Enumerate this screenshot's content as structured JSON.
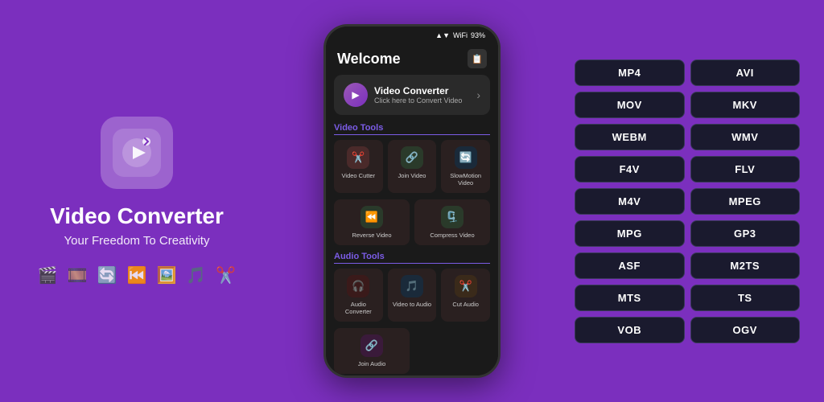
{
  "app": {
    "title": "Video Converter",
    "subtitle": "Your Freedom To Creativity",
    "icon_label": "app-icon"
  },
  "phone": {
    "status_bar": {
      "time": "",
      "signal": "▲▼",
      "wifi": "WiFi",
      "battery": "93%"
    },
    "header": {
      "title": "Welcome",
      "icon": "📋"
    },
    "banner": {
      "title": "Video Converter",
      "subtitle": "Click here to Convert Video"
    },
    "video_tools_label": "Video Tools",
    "video_tools": [
      {
        "name": "Video Cutter",
        "icon": "✂️",
        "color": "#4a2020"
      },
      {
        "name": "Join Video",
        "icon": "🔗",
        "color": "#2a3a20"
      },
      {
        "name": "SlowMotion Video",
        "icon": "🔄",
        "color": "#1a2a3a"
      },
      {
        "name": "Reverse Video",
        "icon": "⏪",
        "color": "#2a3a20"
      },
      {
        "name": "Compress Video",
        "icon": "🗜️",
        "color": "#2a3a20"
      }
    ],
    "audio_tools_label": "Audio Tools",
    "audio_tools": [
      {
        "name": "Audio Converter",
        "icon": "🎧",
        "color": "#3a1a1a"
      },
      {
        "name": "Video to Audio",
        "icon": "🎵",
        "color": "#1a2a3a"
      },
      {
        "name": "Cut Audio",
        "icon": "✂️",
        "color": "#3a2a1a"
      },
      {
        "name": "Join Audio",
        "icon": "🔗",
        "color": "#3a1a3a"
      }
    ]
  },
  "formats": [
    "MP4",
    "AVI",
    "MOV",
    "MKV",
    "WEBM",
    "WMV",
    "F4V",
    "FLV",
    "M4V",
    "MPEG",
    "MPG",
    "GP3",
    "ASF",
    "M2TS",
    "MTS",
    "TS",
    "VOB",
    "OGV"
  ],
  "feature_icons": [
    "🎬",
    "🎞️",
    "🔄",
    "⏮️",
    "🖼️",
    "🎵",
    "✂️"
  ]
}
